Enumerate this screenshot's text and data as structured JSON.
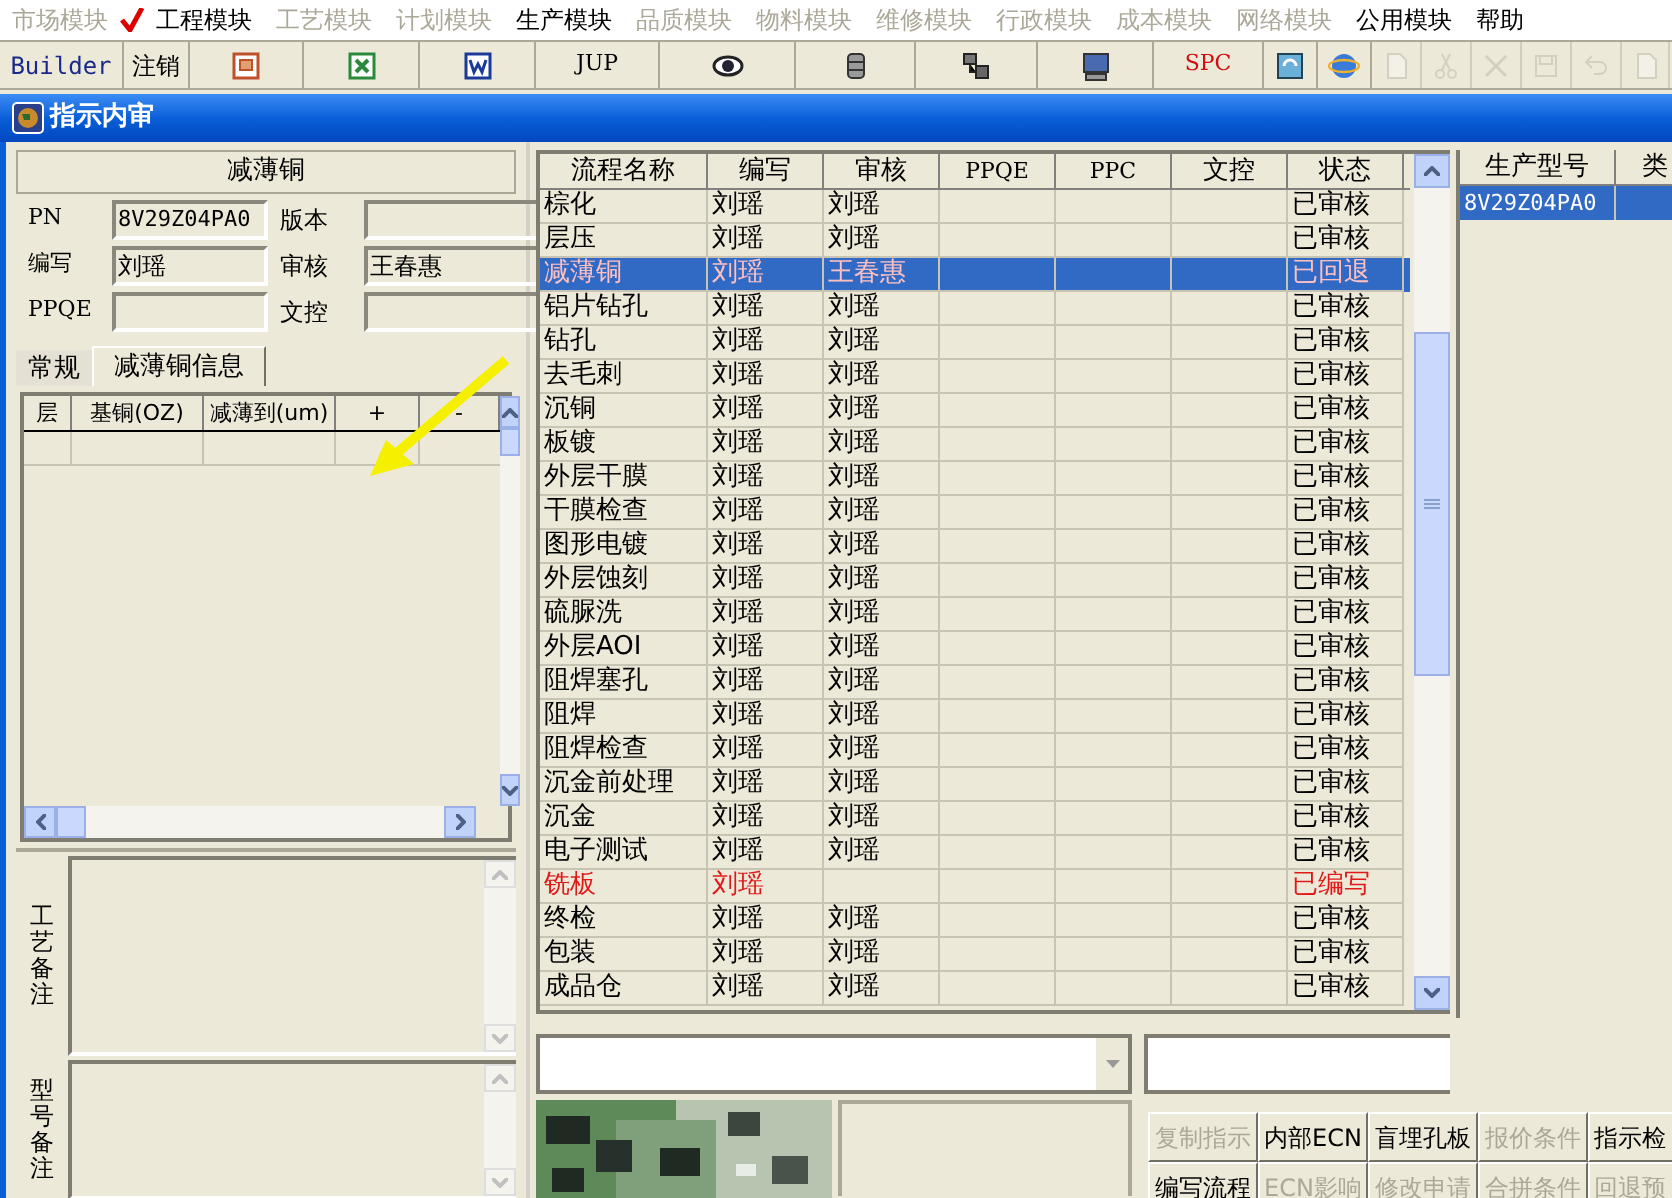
{
  "menu": [
    {
      "label": "市场模块",
      "disabled": true
    },
    {
      "label": "工程模块",
      "disabled": false
    },
    {
      "label": "工艺模块",
      "disabled": true
    },
    {
      "label": "计划模块",
      "disabled": true
    },
    {
      "label": "生产模块",
      "disabled": false
    },
    {
      "label": "品质模块",
      "disabled": true
    },
    {
      "label": "物料模块",
      "disabled": true
    },
    {
      "label": "维修模块",
      "disabled": true
    },
    {
      "label": "行政模块",
      "disabled": true
    },
    {
      "label": "成本模块",
      "disabled": true
    },
    {
      "label": "网络模块",
      "disabled": true
    },
    {
      "label": "公用模块",
      "disabled": false
    },
    {
      "label": "帮助",
      "disabled": false
    }
  ],
  "toolbar": {
    "text_buttons": [
      "Builder",
      "注销",
      "JUP",
      "SPC"
    ],
    "icons": [
      {
        "disabled": false
      },
      {
        "disabled": false
      },
      {
        "disabled": false
      },
      {
        "disabled": false
      },
      {
        "disabled": false
      },
      {
        "disabled": false
      },
      {
        "disabled": false
      },
      {
        "disabled": false
      },
      {
        "disabled": false
      },
      {
        "disabled": true
      },
      {
        "disabled": true
      },
      {
        "disabled": true
      },
      {
        "disabled": true
      },
      {
        "disabled": true
      },
      {
        "disabled": true
      }
    ]
  },
  "window": {
    "title": "指示内审"
  },
  "left": {
    "header": "减薄铜",
    "fields": [
      {
        "label": "PN",
        "value": "8V29Z04PA0"
      },
      {
        "label": "版本"
      },
      {
        "label": "编写",
        "value": "刘瑶"
      },
      {
        "label": "审核",
        "value": "王春惠"
      },
      {
        "label": "PPQE"
      },
      {
        "label": "文控"
      }
    ],
    "tabs": [
      {
        "label": "常规",
        "selected": false
      },
      {
        "label": "减薄铜信息",
        "selected": true
      }
    ],
    "layer_table": {
      "columns": [
        "层",
        "基铜(OZ)",
        "减薄到(um)",
        "+",
        "-"
      ]
    },
    "notes": [
      {
        "label": "工艺备注"
      },
      {
        "label": "型号备注"
      }
    ]
  },
  "process_table": {
    "columns": [
      "流程名称",
      "编写",
      "审核",
      "PPQE",
      "PPC",
      "文控",
      "状态"
    ],
    "rows": [
      {
        "name": "棕化",
        "writer": "刘瑶",
        "reviewer": "刘瑶",
        "status": "已审核",
        "selected": false,
        "flagged": false
      },
      {
        "name": "层压",
        "writer": "刘瑶",
        "reviewer": "刘瑶",
        "status": "已审核",
        "selected": false,
        "flagged": false
      },
      {
        "name": "减薄铜",
        "writer": "刘瑶",
        "reviewer": "王春惠",
        "status": "已回退",
        "selected": true,
        "flagged": true
      },
      {
        "name": "铝片钻孔",
        "writer": "刘瑶",
        "reviewer": "刘瑶",
        "status": "已审核",
        "selected": false,
        "flagged": false
      },
      {
        "name": "钻孔",
        "writer": "刘瑶",
        "reviewer": "刘瑶",
        "status": "已审核",
        "selected": false,
        "flagged": false
      },
      {
        "name": "去毛刺",
        "writer": "刘瑶",
        "reviewer": "刘瑶",
        "status": "已审核",
        "selected": false,
        "flagged": false
      },
      {
        "name": "沉铜",
        "writer": "刘瑶",
        "reviewer": "刘瑶",
        "status": "已审核",
        "selected": false,
        "flagged": false
      },
      {
        "name": "板镀",
        "writer": "刘瑶",
        "reviewer": "刘瑶",
        "status": "已审核",
        "selected": false,
        "flagged": false
      },
      {
        "name": "外层干膜",
        "writer": "刘瑶",
        "reviewer": "刘瑶",
        "status": "已审核",
        "selected": false,
        "flagged": false
      },
      {
        "name": "干膜检查",
        "writer": "刘瑶",
        "reviewer": "刘瑶",
        "status": "已审核",
        "selected": false,
        "flagged": false
      },
      {
        "name": "图形电镀",
        "writer": "刘瑶",
        "reviewer": "刘瑶",
        "status": "已审核",
        "selected": false,
        "flagged": false
      },
      {
        "name": "外层蚀刻",
        "writer": "刘瑶",
        "reviewer": "刘瑶",
        "status": "已审核",
        "selected": false,
        "flagged": false
      },
      {
        "name": "硫脲洗",
        "writer": "刘瑶",
        "reviewer": "刘瑶",
        "status": "已审核",
        "selected": false,
        "flagged": false
      },
      {
        "name": "外层AOI",
        "writer": "刘瑶",
        "reviewer": "刘瑶",
        "status": "已审核",
        "selected": false,
        "flagged": false
      },
      {
        "name": "阻焊塞孔",
        "writer": "刘瑶",
        "reviewer": "刘瑶",
        "status": "已审核",
        "selected": false,
        "flagged": false
      },
      {
        "name": "阻焊",
        "writer": "刘瑶",
        "reviewer": "刘瑶",
        "status": "已审核",
        "selected": false,
        "flagged": false
      },
      {
        "name": "阻焊检查",
        "writer": "刘瑶",
        "reviewer": "刘瑶",
        "status": "已审核",
        "selected": false,
        "flagged": false
      },
      {
        "name": "沉金前处理",
        "writer": "刘瑶",
        "reviewer": "刘瑶",
        "status": "已审核",
        "selected": false,
        "flagged": false
      },
      {
        "name": "沉金",
        "writer": "刘瑶",
        "reviewer": "刘瑶",
        "status": "已审核",
        "selected": false,
        "flagged": false
      },
      {
        "name": "电子测试",
        "writer": "刘瑶",
        "reviewer": "刘瑶",
        "status": "已审核",
        "selected": false,
        "flagged": false
      },
      {
        "name": "铣板",
        "writer": "刘瑶",
        "status": "已编写",
        "selected": false,
        "flagged": true
      },
      {
        "name": "终检",
        "writer": "刘瑶",
        "reviewer": "刘瑶",
        "status": "已审核",
        "selected": false,
        "flagged": false
      },
      {
        "name": "包装",
        "writer": "刘瑶",
        "reviewer": "刘瑶",
        "status": "已审核",
        "selected": false,
        "flagged": false
      },
      {
        "name": "成品仓",
        "writer": "刘瑶",
        "reviewer": "刘瑶",
        "status": "已审核",
        "selected": false,
        "flagged": false
      }
    ]
  },
  "model_table": {
    "columns": [
      "生产型号",
      "类"
    ],
    "rows": [
      {
        "model": "8V29Z04PA0",
        "selected": true
      }
    ]
  },
  "actions": [
    [
      {
        "label": "复制指示",
        "disabled": true
      },
      {
        "label": "内部ECN",
        "disabled": false
      },
      {
        "label": "盲埋孔板",
        "disabled": false
      },
      {
        "label": "报价条件",
        "disabled": true
      },
      {
        "label": "指示检",
        "disabled": false
      }
    ],
    [
      {
        "label": "编写流程",
        "disabled": false
      },
      {
        "label": "ECN影响",
        "disabled": true
      },
      {
        "label": "修改申请",
        "disabled": true
      },
      {
        "label": "合拼条件",
        "disabled": true
      },
      {
        "label": "回退预",
        "disabled": true
      }
    ]
  ]
}
